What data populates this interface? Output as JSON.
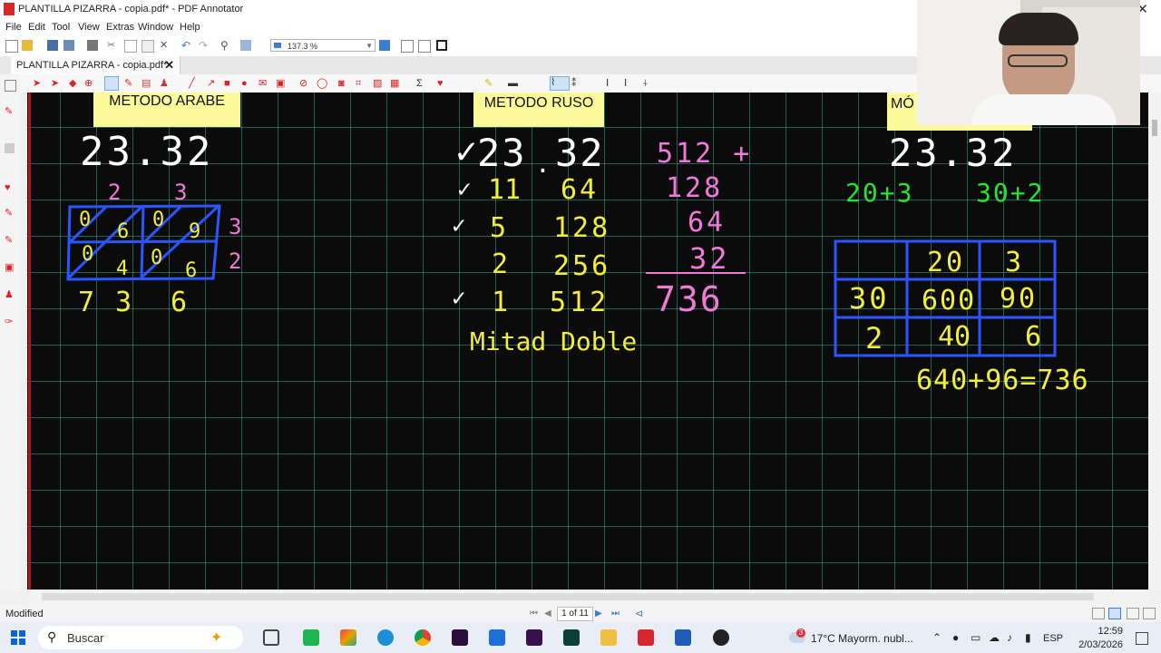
{
  "window": {
    "title": "PLANTILLA PIZARRA - copia.pdf* - PDF Annotator"
  },
  "menu": [
    "File",
    "Edit",
    "Tool",
    "View",
    "Extras",
    "Window",
    "Help"
  ],
  "toolbar": {
    "zoom": "137.3 %"
  },
  "tab": {
    "label": "PLANTILLA PIZARRA - copia.pdf*",
    "close": "✕"
  },
  "board": {
    "arabe": {
      "label": "METODO ARABE",
      "header": "23.32",
      "top_digits": [
        "2",
        "3"
      ],
      "cells": [
        [
          "0",
          "6"
        ],
        [
          "0",
          "9"
        ],
        [
          "0",
          "4"
        ],
        [
          "0",
          "6"
        ]
      ],
      "right_digits": [
        "3",
        "2"
      ],
      "result": [
        "7",
        "3",
        "6"
      ]
    },
    "ruso": {
      "label": "METODO RUSO",
      "header": "23.32",
      "rows": [
        {
          "check": "✓",
          "left": "23",
          "right": "32"
        },
        {
          "check": "✓",
          "left": "11",
          "right": "64"
        },
        {
          "check": "✓",
          "left": "5",
          "right": "128"
        },
        {
          "check": "",
          "left": "2",
          "right": "256"
        },
        {
          "check": "✓",
          "left": "1",
          "right": "512"
        }
      ],
      "sum_items": [
        "512 +",
        "128",
        "64",
        "32"
      ],
      "sum_result": "736",
      "footer_left": "Mitad",
      "footer_right": "Doble"
    },
    "modulo": {
      "label": "MÓ",
      "header": "23.32",
      "expansion_left": "20+3",
      "expansion_right": "30+2",
      "grid": [
        [
          "",
          "20",
          "3"
        ],
        [
          "30",
          "600",
          "90"
        ],
        [
          "2",
          "40",
          "6"
        ]
      ],
      "result": "640+96=736"
    }
  },
  "status": {
    "modified": "Modified",
    "page": "1 of 11"
  },
  "taskbar": {
    "search": "Buscar",
    "weather": "17°C  Mayorm. nubl...",
    "badge": "3",
    "lang": "ESP",
    "time": "12:59",
    "date": "2/03/2026"
  },
  "colors": {
    "accent": "#3c7ecc",
    "board": "#0b0b0b",
    "grid_line": "#46c8aa",
    "ink_yellow": "#f2ee3a",
    "ink_pink": "#f07ad8",
    "ink_green": "#25e52c",
    "ink_blue": "#2b56ff",
    "margin_red": "#b3131a"
  }
}
